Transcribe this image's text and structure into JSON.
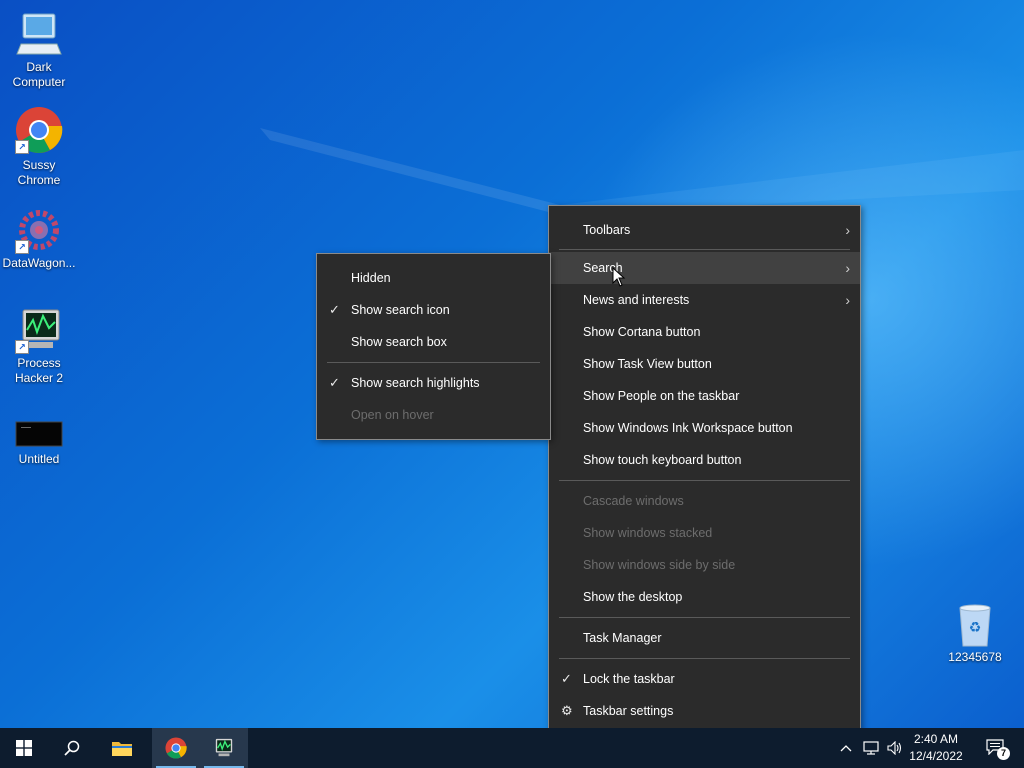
{
  "desktop": {
    "icons": [
      {
        "label": "Dark Computer"
      },
      {
        "label": "Sussy Chrome"
      },
      {
        "label": "DataWagon..."
      },
      {
        "label": "Process Hacker 2"
      },
      {
        "label": "Untitled"
      },
      {
        "label": "12345678"
      }
    ]
  },
  "context_menu": {
    "items": [
      {
        "label": "Toolbars",
        "submenu": true
      },
      {
        "label": "Search",
        "submenu": true,
        "highlighted": true
      },
      {
        "label": "News and interests",
        "submenu": true
      },
      {
        "label": "Show Cortana button"
      },
      {
        "label": "Show Task View button"
      },
      {
        "label": "Show People on the taskbar"
      },
      {
        "label": "Show Windows Ink Workspace button"
      },
      {
        "label": "Show touch keyboard button"
      },
      {
        "label": "Cascade windows",
        "disabled": true
      },
      {
        "label": "Show windows stacked",
        "disabled": true
      },
      {
        "label": "Show windows side by side",
        "disabled": true
      },
      {
        "label": "Show the desktop"
      },
      {
        "label": "Task Manager"
      },
      {
        "label": "Lock the taskbar",
        "checked": true
      },
      {
        "label": "Taskbar settings",
        "icon": "gear-icon"
      }
    ]
  },
  "search_submenu": {
    "items": [
      {
        "label": "Hidden"
      },
      {
        "label": "Show search icon",
        "checked": true
      },
      {
        "label": "Show search box"
      },
      {
        "label": "Show search highlights",
        "checked": true
      },
      {
        "label": "Open on hover",
        "disabled": true
      }
    ]
  },
  "taskbar": {
    "apps": [
      "start-icon",
      "search-icon",
      "file-explorer-icon",
      "chrome-icon",
      "process-hacker-icon"
    ],
    "clock": {
      "time": "2:40 AM",
      "date": "12/4/2022"
    },
    "notification_count": "7"
  },
  "colors": {
    "menu_bg": "#2b2b2b",
    "menu_hover": "#414141",
    "taskbar_bg": "#0d1c2e",
    "desktop_blue": "#0b6fd6"
  }
}
